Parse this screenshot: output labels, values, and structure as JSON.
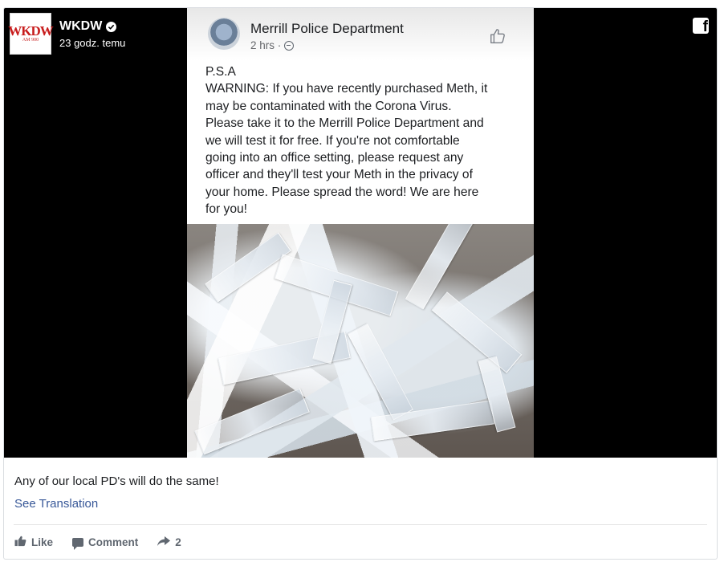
{
  "post": {
    "page_name": "WKDW",
    "time": "23 godz. temu",
    "caption": "Any of our local PD's will do the same!",
    "see_translation": "See Translation",
    "actions": {
      "like": "Like",
      "comment": "Comment",
      "share_count": "2"
    }
  },
  "logo": {
    "main": "WKDW",
    "sub": "AM 900"
  },
  "shared_post": {
    "name": "Merrill Police Department",
    "time": "2 hrs ·",
    "text_lines": [
      "P.S.A",
      "WARNING: If you have recently purchased Meth, it",
      "may be contaminated with the Corona Virus.",
      "Please take it to the  Merrill Police Department and",
      "we will test it for free. If you're not comfortable",
      "going into an office setting, please request any",
      "officer and they'll test your Meth in the privacy of",
      "your home.  Please spread the word! We are here",
      "for you!"
    ]
  },
  "icons": {
    "verified": "verified-badge-icon",
    "facebook": "facebook-logo-icon",
    "globe": "globe-icon",
    "thumb": "thumbs-up-outline-icon",
    "like": "like-icon",
    "comment": "comment-icon",
    "share": "share-icon"
  },
  "colors": {
    "link": "#385898",
    "action_text": "#606770",
    "media_background": "#000000"
  }
}
